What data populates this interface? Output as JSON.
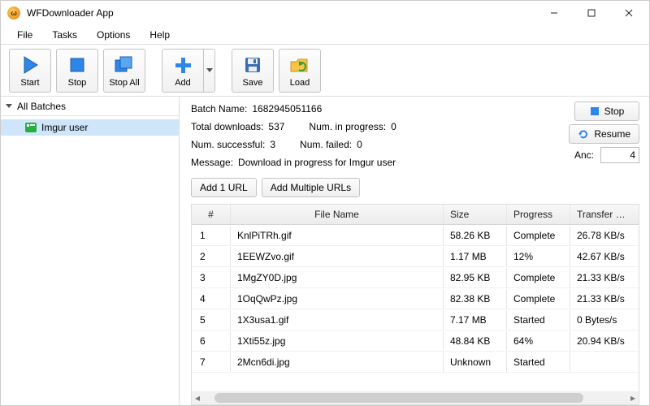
{
  "window": {
    "title": "WFDownloader App"
  },
  "menu": {
    "file": "File",
    "tasks": "Tasks",
    "options": "Options",
    "help": "Help"
  },
  "toolbar": {
    "start": "Start",
    "stop": "Stop",
    "stopall": "Stop All",
    "add": "Add",
    "save": "Save",
    "load": "Load"
  },
  "sidebar": {
    "header": "All Batches",
    "items": [
      {
        "label": "Imgur user"
      }
    ]
  },
  "stats": {
    "batch_label": "Batch Name:",
    "batch_value": "1682945051166",
    "total_label": "Total downloads:",
    "total_value": "537",
    "inprog_label": "Num. in progress:",
    "inprog_value": "0",
    "success_label": "Num. successful:",
    "success_value": "3",
    "failed_label": "Num. failed:",
    "failed_value": "0",
    "message_label": "Message:",
    "message_value": "Download in progress for Imgur user"
  },
  "side_buttons": {
    "stop": "Stop",
    "resume": "Resume",
    "anc_label": "Anc:",
    "anc_value": "4"
  },
  "url_buttons": {
    "add1": "Add 1 URL",
    "addmulti": "Add Multiple URLs"
  },
  "table": {
    "headers": {
      "idx": "#",
      "name": "File Name",
      "size": "Size",
      "progress": "Progress",
      "rate": "Transfer Rate"
    },
    "rows": [
      {
        "idx": "1",
        "name": "KnlPiTRh.gif",
        "size": "58.26 KB",
        "progress": "Complete",
        "rate": "26.78 KB/s"
      },
      {
        "idx": "2",
        "name": "1EEWZvo.gif",
        "size": "1.17 MB",
        "progress": "12%",
        "rate": "42.67 KB/s"
      },
      {
        "idx": "3",
        "name": "1MgZY0D.jpg",
        "size": "82.95 KB",
        "progress": "Complete",
        "rate": "21.33 KB/s"
      },
      {
        "idx": "4",
        "name": "1OqQwPz.jpg",
        "size": "82.38 KB",
        "progress": "Complete",
        "rate": "21.33 KB/s"
      },
      {
        "idx": "5",
        "name": "1X3usa1.gif",
        "size": "7.17 MB",
        "progress": "Started",
        "rate": "0 Bytes/s"
      },
      {
        "idx": "6",
        "name": "1Xti55z.jpg",
        "size": "48.84 KB",
        "progress": "64%",
        "rate": "20.94 KB/s"
      },
      {
        "idx": "7",
        "name": "2Mcn6di.jpg",
        "size": "Unknown",
        "progress": "Started",
        "rate": ""
      }
    ]
  }
}
